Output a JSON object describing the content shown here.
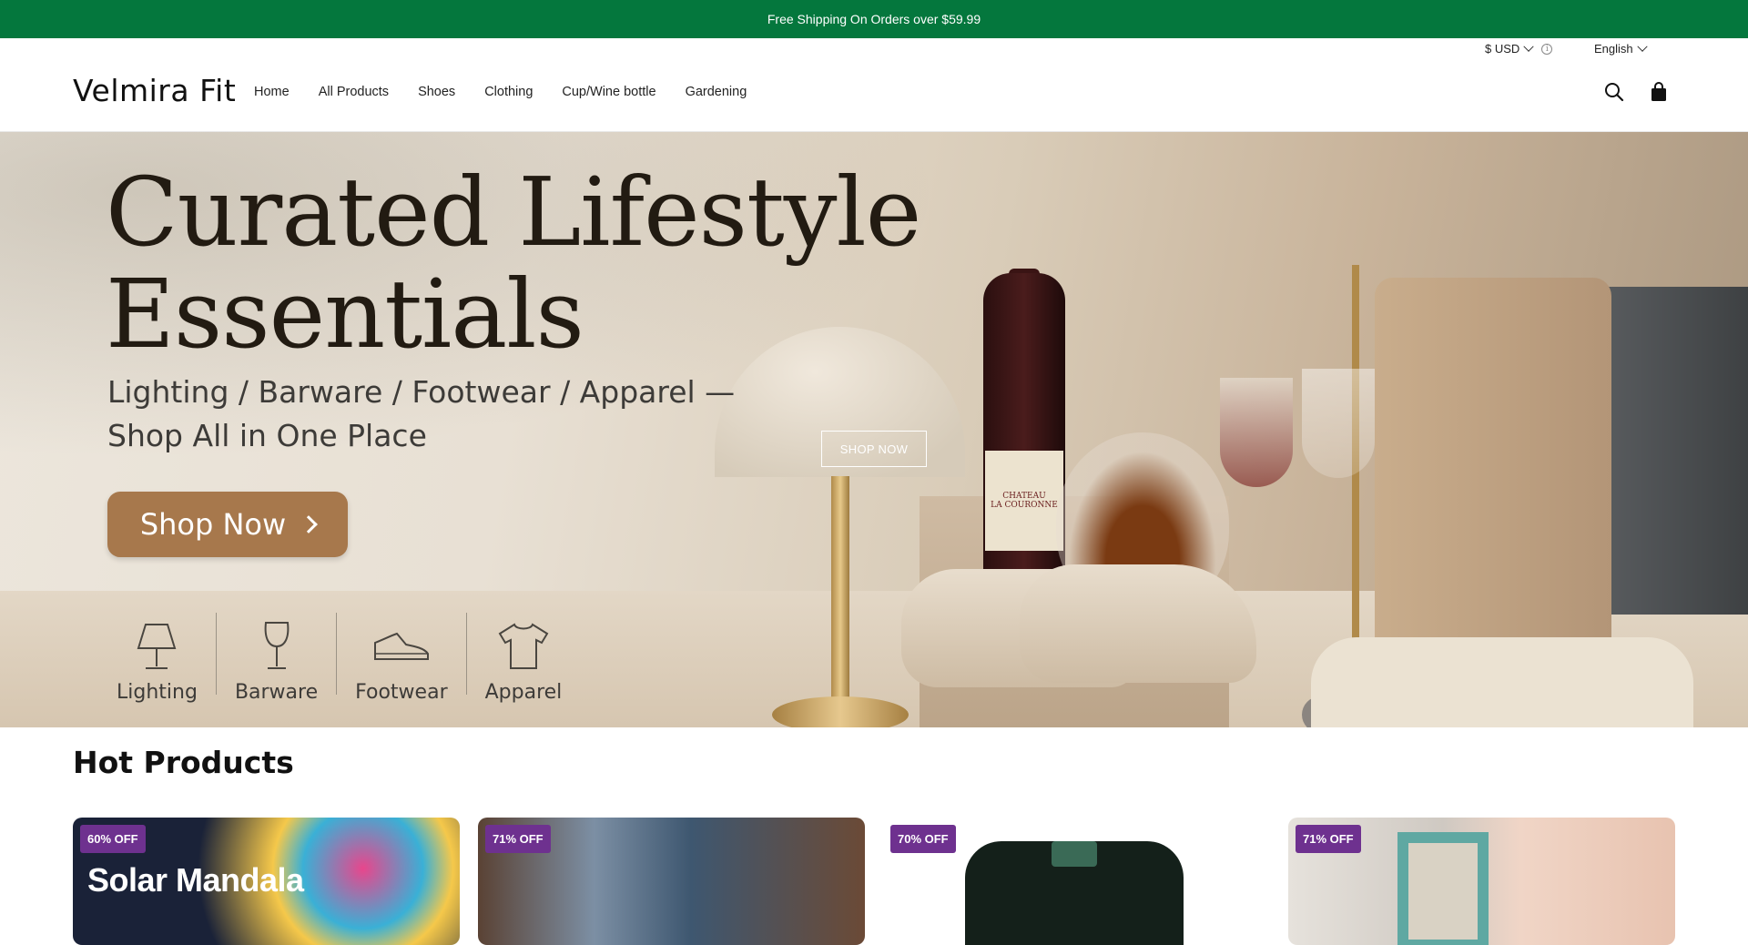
{
  "announcement": {
    "text": "Free Shipping On Orders over $59.99"
  },
  "utility": {
    "currency": "$ USD",
    "language": "English"
  },
  "header": {
    "logo": "Velmira Fit",
    "nav": [
      {
        "label": "Home"
      },
      {
        "label": "All Products"
      },
      {
        "label": "Shoes"
      },
      {
        "label": "Clothing"
      },
      {
        "label": "Cup/Wine bottle"
      },
      {
        "label": "Gardening"
      }
    ],
    "icons": [
      "search-icon",
      "cart-icon"
    ]
  },
  "hero": {
    "title_line1": "Curated Lifestyle",
    "title_line2": "Essentials",
    "subtitle_line1": "Lighting / Barware / Footwear / Apparel —",
    "subtitle_line2": "Shop All in One Place",
    "cta": "Shop Now",
    "overlay_button": "SHOP NOW",
    "categories": [
      {
        "label": "Lighting",
        "icon": "lamp-icon"
      },
      {
        "label": "Barware",
        "icon": "wine-glass-icon"
      },
      {
        "label": "Footwear",
        "icon": "sneaker-icon"
      },
      {
        "label": "Apparel",
        "icon": "tshirt-icon"
      }
    ],
    "bottle_label_line1": "CHATEAU",
    "bottle_label_line2": "LA COURONNE"
  },
  "hot_products": {
    "title": "Hot Products",
    "items": [
      {
        "badge": "60% OFF",
        "image_text": "Solar Mandala"
      },
      {
        "badge": "71% OFF"
      },
      {
        "badge": "70% OFF"
      },
      {
        "badge": "71% OFF"
      }
    ]
  },
  "colors": {
    "announcement_bg": "#04773d",
    "badge_bg": "#6e318f",
    "cta_bg": "#a7784c"
  }
}
